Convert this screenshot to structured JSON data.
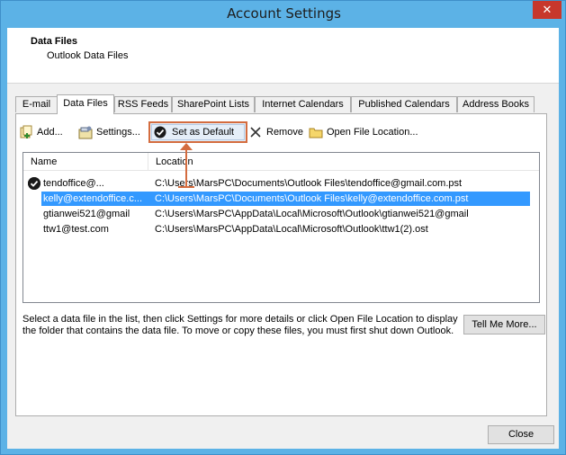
{
  "window": {
    "title": "Account Settings",
    "close_glyph": "✕"
  },
  "header": {
    "title": "Data Files",
    "subtitle": "Outlook Data Files"
  },
  "tabs": [
    {
      "label": "E-mail"
    },
    {
      "label": "Data Files"
    },
    {
      "label": "RSS Feeds"
    },
    {
      "label": "SharePoint Lists"
    },
    {
      "label": "Internet Calendars"
    },
    {
      "label": "Published Calendars"
    },
    {
      "label": "Address Books"
    }
  ],
  "toolbar": {
    "add_label": "Add...",
    "settings_label": "Settings...",
    "set_default_label": "Set as Default",
    "remove_label": "Remove",
    "open_location_label": "Open File Location..."
  },
  "list": {
    "columns": [
      "Name",
      "Location"
    ],
    "rows": [
      {
        "name": "tendoffice@...",
        "location": "C:\\Users\\MarsPC\\Documents\\Outlook Files\\tendoffice@gmail.com.pst",
        "is_default": true
      },
      {
        "name": "kelly@extendoffice.c...",
        "location": "C:\\Users\\MarsPC\\Documents\\Outlook Files\\kelly@extendoffice.com.pst",
        "selected": true
      },
      {
        "name": "gtianwei521@gmail",
        "location": "C:\\Users\\MarsPC\\AppData\\Local\\Microsoft\\Outlook\\gtianwei521@gmail"
      },
      {
        "name": "ttw1@test.com",
        "location": "C:\\Users\\MarsPC\\AppData\\Local\\Microsoft\\Outlook\\ttw1(2).ost"
      }
    ]
  },
  "description": "Select a data file in the list, then click Settings for more details or click Open File Location to display the folder that contains the data file. To move or copy these files, you must first shut down Outlook.",
  "tell_me_more_label": "Tell Me More...",
  "close_label": "Close",
  "colors": {
    "titlebar": "#5cb2e6",
    "selection": "#3399ff",
    "highlight": "#d46c3f"
  }
}
